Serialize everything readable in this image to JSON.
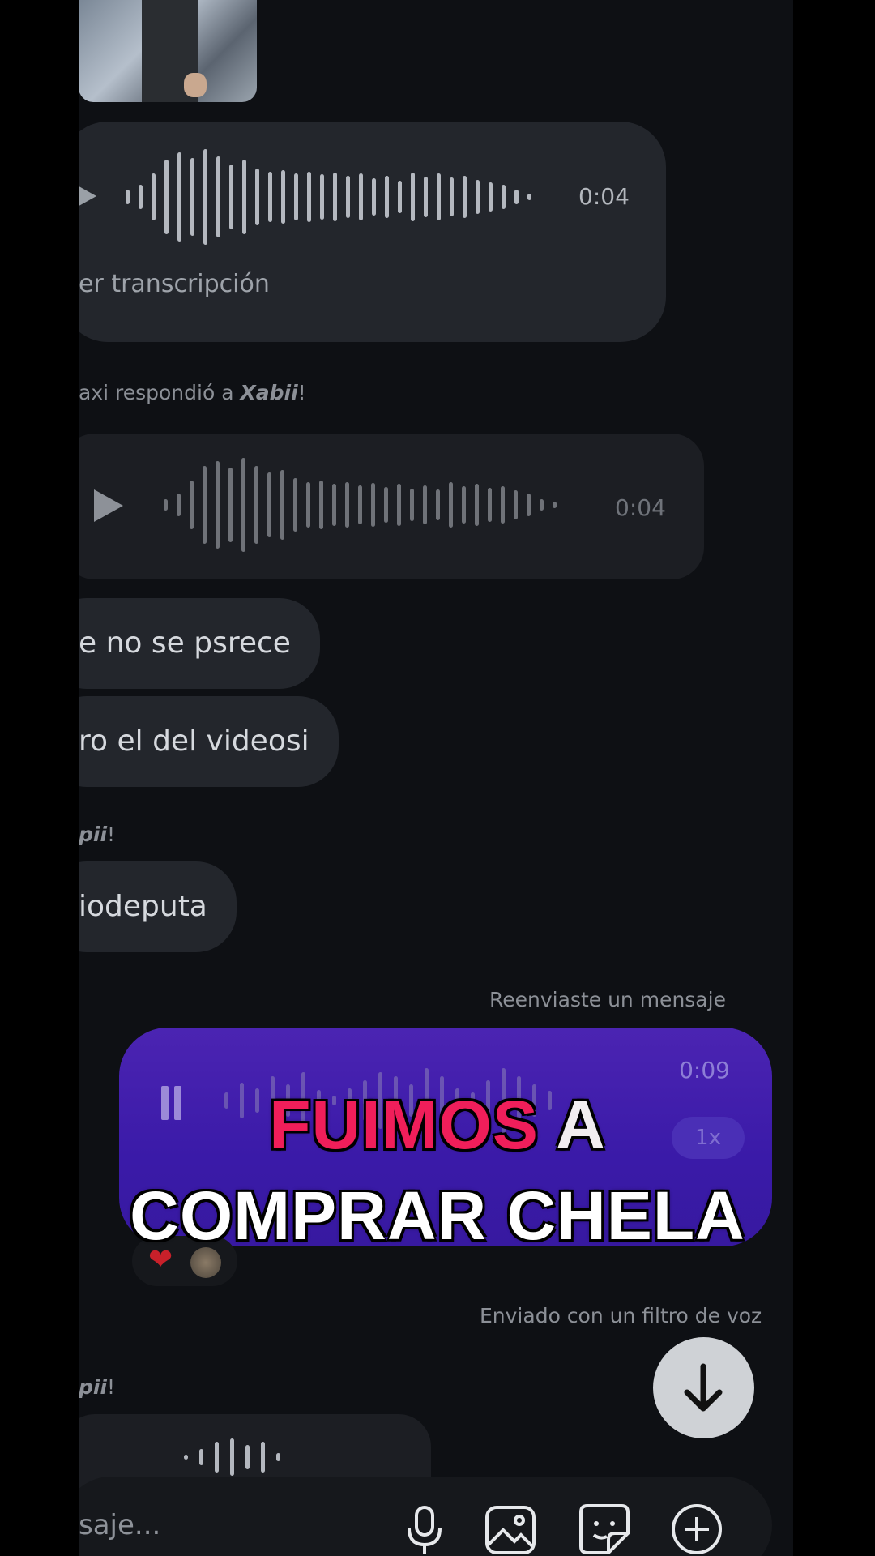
{
  "chat": {
    "voice_message_1": {
      "duration": "0:04",
      "transcription_link": "er transcripción"
    },
    "reply_notice": {
      "prefix": "axi respondió a ",
      "name": "Xabii",
      "suffix": "!"
    },
    "voice_message_2": {
      "duration": "0:04"
    },
    "text_messages": [
      "e no se psrece",
      "ro el del videosi"
    ],
    "name_fragment_1": "pii",
    "name_fragment_1_suffix": "!",
    "text_message_3": "iodeputa",
    "forwarded_notice": "Reenviaste un mensaje",
    "sent_voice": {
      "duration": "0:09",
      "speed": "1x"
    },
    "reactions": {
      "emoji": "❤"
    },
    "voice_filter_notice": "Enviado con un filtro de voz",
    "name_fragment_2": "pii",
    "name_fragment_2_suffix": "!"
  },
  "caption": {
    "line1_pink": "FUIMOS",
    "line1_white": "A",
    "line2": "COMPRAR CHELA"
  },
  "composer": {
    "placeholder": "saje..."
  },
  "icons": [
    "play-icon",
    "pause-icon",
    "arrow-down-icon",
    "microphone-icon",
    "image-icon",
    "sticker-icon",
    "plus-icon",
    "heart-icon"
  ]
}
